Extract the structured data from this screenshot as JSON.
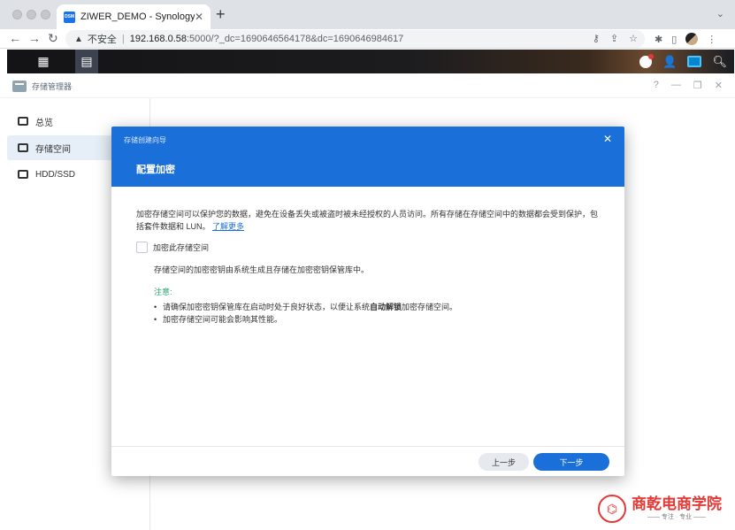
{
  "browser": {
    "tab_title": "ZIWER_DEMO - Synology NAS",
    "favicon_text": "DSM",
    "security_label": "不安全",
    "url_host": "192.168.0.58",
    "url_rest": ":5000/?_dc=1690646564178&dc=1690646984617"
  },
  "app": {
    "title": "存储管理器",
    "sidebar": [
      {
        "label": "总览"
      },
      {
        "label": "存储空间"
      },
      {
        "label": "HDD/SSD"
      }
    ]
  },
  "modal": {
    "wizard_title": "存储创建向导",
    "step_title": "配置加密",
    "description": "加密存储空间可以保护您的数据，避免在设备丢失或被盗时被未经授权的人员访问。所有存储在存储空间中的数据都会受到保护，包括套件数据和 LUN。",
    "learn_more": "了解更多",
    "checkbox_label": "加密此存储空间",
    "subtext": "存储空间的加密密钥由系统生成且存储在加密密钥保管库中。",
    "note_title": "注意:",
    "note_1_pre": "请确保加密密钥保管库在启动时处于良好状态，以便让系统",
    "note_1_bold": "自动解锁",
    "note_1_post": "加密存储空间。",
    "note_2": "加密存储空间可能会影响其性能。",
    "prev_button": "上一步",
    "next_button": "下一步"
  },
  "brand": {
    "name": "商乾电商学院",
    "slogan": "—— 专注 · 专业 ——"
  }
}
